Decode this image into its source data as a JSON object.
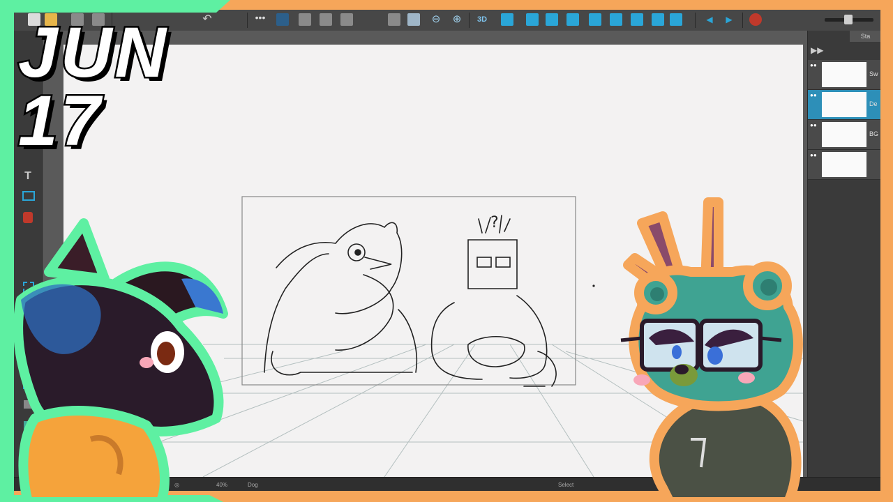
{
  "title_overlay": {
    "month": "JUN",
    "day": "17"
  },
  "colors": {
    "frame_green": "#5ef0a2",
    "frame_orange": "#f6a65a",
    "ui_dark": "#3d3d3d",
    "accent_blue": "#2d8fb8"
  },
  "toolbar": {
    "icons": [
      "new-file-icon",
      "open-file-icon",
      "save-icon",
      "save-all-icon",
      "undo-icon",
      "more-icon",
      "onion-skin-icon",
      "grid-icon",
      "grid-settings-icon",
      "frame-icon",
      "camera-icon",
      "zoom-in-icon",
      "zoom-out-icon",
      "3d-icon",
      "deform-icon",
      "brush-icon",
      "pencil-icon",
      "cutter-icon",
      "transform-icon",
      "contour-icon",
      "bone-icon",
      "prev-frame-icon",
      "next-frame-icon",
      "color-pot-icon"
    ],
    "three_d_label": "3D"
  },
  "layers_panel": {
    "tab_label": "Sta",
    "layers": [
      {
        "name": "Sw",
        "active": false
      },
      {
        "name": "De",
        "active": true
      },
      {
        "name": "BG",
        "active": false
      },
      {
        "name": "",
        "active": false
      }
    ]
  },
  "statusbar": {
    "zoom": "40%",
    "drawing": "Dog",
    "mode": "Select"
  },
  "sketch": {
    "question_mark": "?"
  }
}
